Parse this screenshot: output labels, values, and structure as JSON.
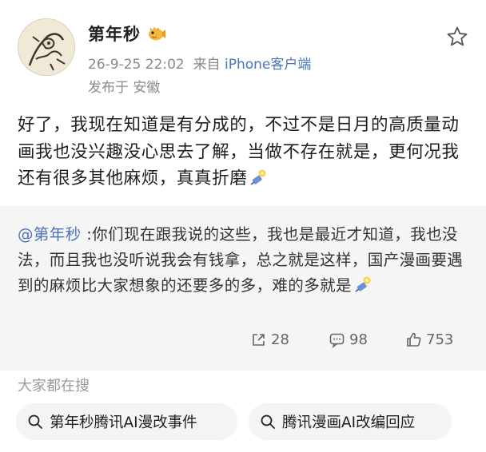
{
  "post": {
    "author": "第年秒",
    "timestamp": "26-9-25 22:02",
    "source_prefix": "来自",
    "source": "iPhone客户端",
    "location": "发布于 安徽",
    "text": "好了，我现在知道是有分成的，不过不是日月的高质量动画我也没兴趣没心思去了解，当做不存在就是，更何况我还有很多其他麻烦，真真折磨"
  },
  "quote": {
    "mention": "@第年秒",
    "text": " :你们现在跟我说的这些，我也是最近才知道，我也没法，而且我也没听说我会有钱拿，总之就是这样，国产漫画要遇到的麻烦比大家想象的还要多的多，难的多就是"
  },
  "stats": {
    "reposts": "28",
    "comments": "98",
    "likes": "753"
  },
  "search": {
    "title": "大家都在搜",
    "chips": [
      "第年秒腾讯AI漫改事件",
      "腾讯漫画AI改编回应"
    ]
  },
  "icons": {
    "favorite": "star-outline-icon",
    "badge": "pufferfish-badge-icon",
    "emoji": "candle-emoji-icon",
    "repost": "repost-icon",
    "comment": "comment-icon",
    "like": "thumbs-up-icon",
    "search": "search-icon"
  },
  "colors": {
    "link": "#4a74b7",
    "meta": "#8a8a8a",
    "quote_bg": "#f5f5f5"
  }
}
